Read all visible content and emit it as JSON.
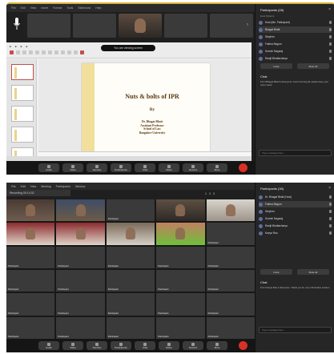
{
  "screenshot1": {
    "menubar": [
      "File",
      "Edit",
      "View",
      "Insert",
      "Format",
      "Tools",
      "Slideshow",
      "Help"
    ],
    "strip": [
      {
        "name": "",
        "camera": false
      },
      {
        "name": "",
        "camera": false
      },
      {
        "name": "",
        "camera": true
      },
      {
        "name": "",
        "camera": false
      },
      {
        "name": "",
        "camera": false
      }
    ],
    "share_banner": "You are viewing screen",
    "slide": {
      "title": "Nuts & bolts of IPR",
      "by": "By",
      "author_lines": [
        "Dr. Bhagat Bhatt",
        "Assistant Professor",
        "School of Law",
        "Bangalore University"
      ]
    },
    "panel": {
      "title": "Participants (28)",
      "subtitle": "Host Options",
      "participants": [
        "Host (Me, Participant)",
        "Bhagat Bhatt",
        "Stephen",
        "Fatima Begum",
        "Suresh Nagaraj",
        "Ranjit Bhattacharya"
      ],
      "buttons": [
        "Invite",
        "Mute All"
      ],
      "chat_title": "Chat",
      "chat_message": "From Bhagat Bhatt to Everyone: Good morning all, please keep your mics muted",
      "chat_input": "Type message here..."
    },
    "toolbar": [
      "Audio",
      "Video",
      "Security",
      "Participants",
      "Chat",
      "Share",
      "Record",
      "More"
    ]
  },
  "screenshot2": {
    "menubar": [
      "File",
      "Edit",
      "View",
      "Meeting",
      "Participants",
      "Window"
    ],
    "rec_label": "Recording 00:14:32",
    "top_controls": [
      "1",
      "2",
      "3"
    ],
    "grid": [
      {
        "name": "",
        "video": 1
      },
      {
        "name": "",
        "video": 2
      },
      {
        "name": "Participant",
        "video": 0
      },
      {
        "name": "",
        "video": 3
      },
      {
        "name": "",
        "video": 4
      },
      {
        "name": "",
        "video": 5
      },
      {
        "name": "",
        "video": 5
      },
      {
        "name": "",
        "video": 6
      },
      {
        "name": "",
        "video": 8
      },
      {
        "name": "Participant",
        "video": 0
      },
      {
        "name": "Participant",
        "video": 0
      },
      {
        "name": "Participant",
        "video": 0
      },
      {
        "name": "Participant",
        "video": 0
      },
      {
        "name": "Participant",
        "video": 0
      },
      {
        "name": "Participant",
        "video": 0
      },
      {
        "name": "Participant",
        "video": 0
      },
      {
        "name": "Participant",
        "video": 0
      },
      {
        "name": "Participant",
        "video": 0
      },
      {
        "name": "Participant",
        "video": 0
      },
      {
        "name": "Participant",
        "video": 0
      },
      {
        "name": "Participant",
        "video": 0
      },
      {
        "name": "Participant",
        "video": 0
      },
      {
        "name": "Participant",
        "video": 0
      },
      {
        "name": "Participant",
        "video": 0
      },
      {
        "name": "Participant",
        "video": 0
      },
      {
        "name": "Participant",
        "video": 0
      },
      {
        "name": "Participant",
        "video": 0
      },
      {
        "name": "Participant",
        "video": 0
      },
      {
        "name": "Participant",
        "video": 0
      },
      {
        "name": "Participant",
        "video": 0
      }
    ],
    "panel": {
      "title": "Participants (30)",
      "participants": [
        "Dr. Bhagat Bhatt (Host)",
        "Fatima Begum",
        "Stephen",
        "Suresh Nagaraj",
        "Ranjit Bhattacharya",
        "Kavya Rao"
      ],
      "buttons": [
        "Invite",
        "Mute All"
      ],
      "chat_title": "Chat",
      "chat_message": "From Kavya Rao to Everyone: Thank you sir, very informative session",
      "chat_input": "Type message here..."
    },
    "toolbar": [
      "Audio",
      "Video",
      "Security",
      "Participants",
      "Chat",
      "Share",
      "Record",
      "More"
    ]
  },
  "colors": {
    "accent_border": "#d7b23a",
    "end_button": "#d93025",
    "slide_band": "#f2df9c"
  }
}
